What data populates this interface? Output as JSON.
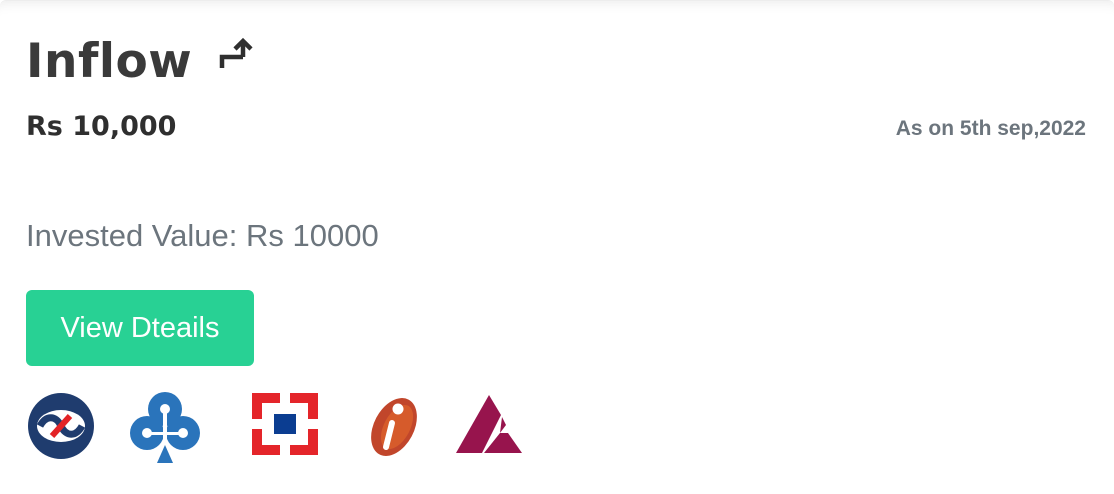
{
  "card": {
    "title": "Inflow",
    "title_icon": "turn-up-right-arrow-icon",
    "amount": "Rs 10,000",
    "as_on": "As on 5th sep,2022",
    "invested_label": "Invested Value: Rs 10000",
    "button_label": "View Dteails"
  },
  "colors": {
    "button_bg": "#28d194",
    "title": "#3a3a3a",
    "muted_text": "#6c757d",
    "kotak_blue": "#1f3c6e",
    "kotak_red": "#e32326",
    "sbi_blue": "#2a74bb",
    "hdfc_red": "#e4252a",
    "hdfc_blue": "#0b3d91",
    "icici_orange": "#c1462b",
    "axis_maroon": "#97144d"
  },
  "logos": [
    {
      "icon": "kotak-logo-icon"
    },
    {
      "icon": "sbi-logo-icon"
    },
    {
      "icon": "hdfc-logo-icon"
    },
    {
      "icon": "icici-logo-icon"
    },
    {
      "icon": "axis-logo-icon"
    }
  ]
}
